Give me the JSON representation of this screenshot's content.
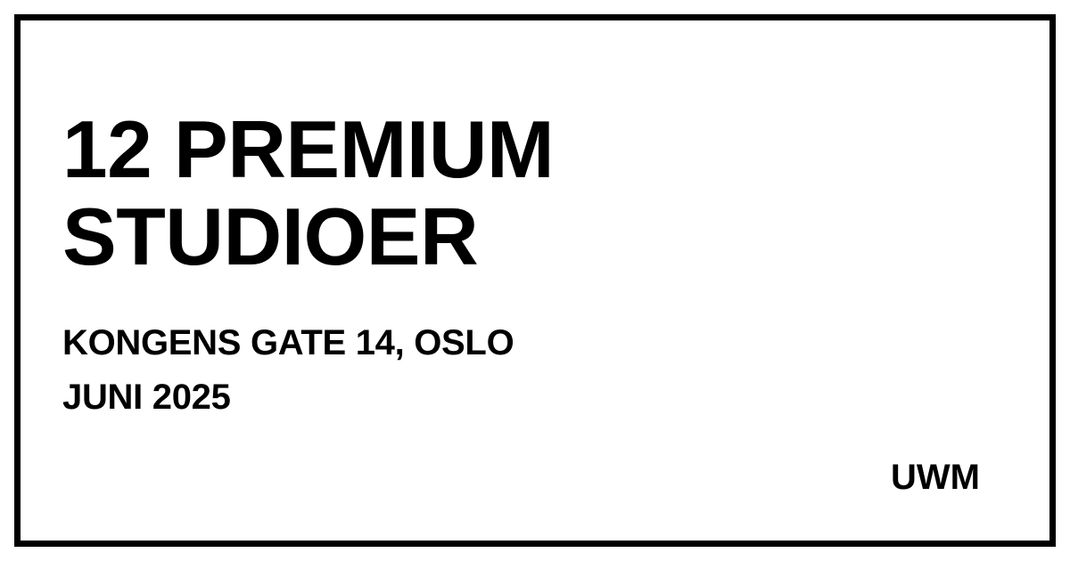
{
  "headline": {
    "line1": "12 PREMIUM",
    "line2": "STUDIOER"
  },
  "address": "KONGENS GATE 14, OSLO",
  "date": "JUNI 2025",
  "brand": "UWM",
  "colors": {
    "background": "#ffffff",
    "text": "#000000",
    "border": "#000000"
  }
}
